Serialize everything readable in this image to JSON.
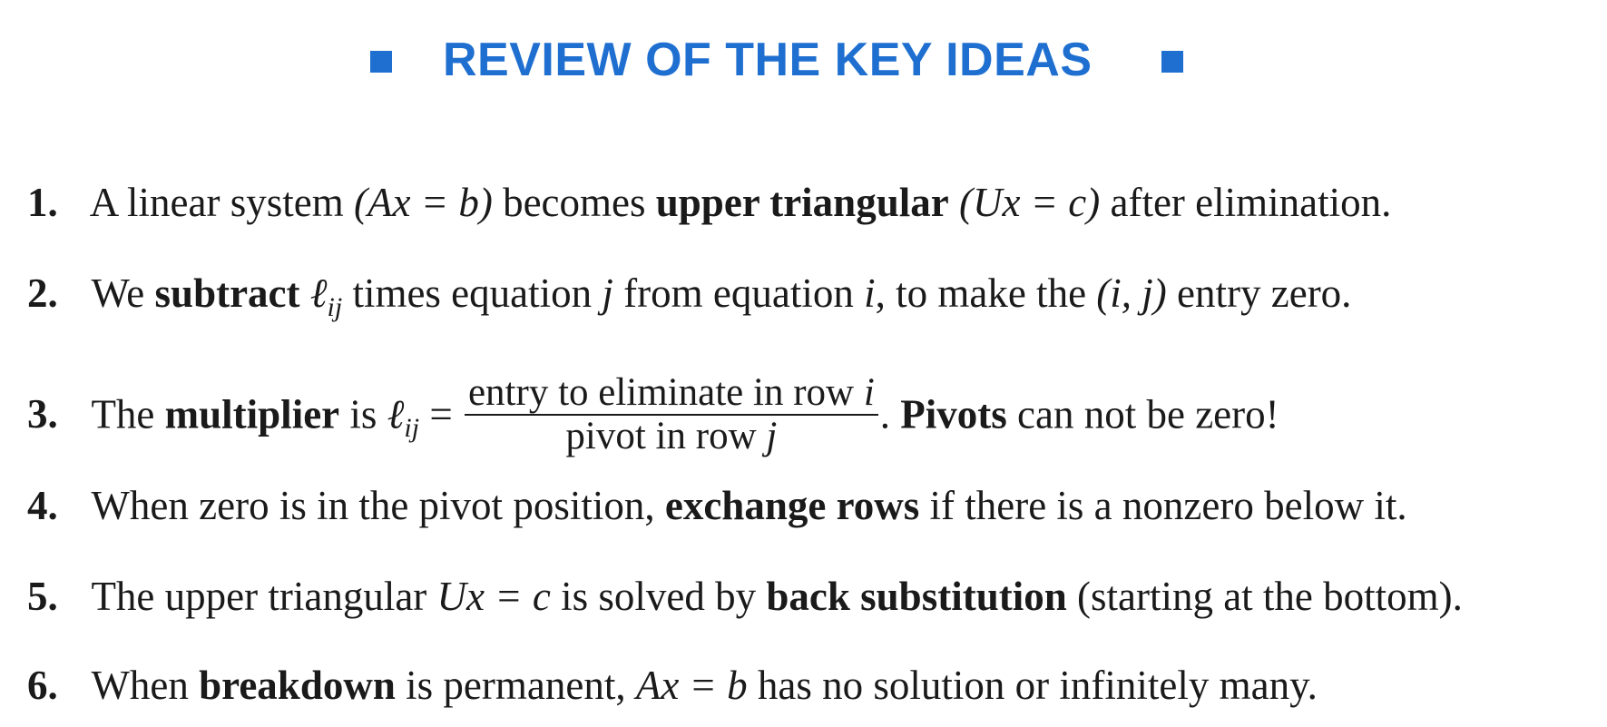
{
  "header": {
    "title": "REVIEW OF THE KEY IDEAS",
    "accent_color": "#1f6fd0"
  },
  "items": [
    {
      "num": "1.",
      "t1": "A linear system",
      "m1": "(Ax = b)",
      "t2": "becomes",
      "bold": "upper triangular",
      "m2": "(Ux = c)",
      "t3": "after elimination."
    },
    {
      "num": "2.",
      "t1": "We",
      "bold": "subtract",
      "ell": "ℓ",
      "sub": "ij",
      "t2": "times equation",
      "m1": "j",
      "t3": "from equation",
      "m2": "i",
      "t4": ", to make the",
      "m3": "(i, j)",
      "t5": "entry zero."
    },
    {
      "num": "3.",
      "t1": "The",
      "bold": "multiplier",
      "t2": "is",
      "ell": "ℓ",
      "sub": "ij",
      "eq": "=",
      "numerator": "entry to eliminate in row",
      "numerator_var": "i",
      "denominator": "pivot in row",
      "denominator_var": "j",
      "t3": ".",
      "bold2": "Pivots",
      "t4": "can not be zero!"
    },
    {
      "num": "4.",
      "t1": "When zero is in the pivot position,",
      "bold": "exchange rows",
      "t2": "if there is a nonzero below it."
    },
    {
      "num": "5.",
      "t1": "The upper triangular",
      "m1": "Ux = c",
      "t2": "is solved by",
      "bold": "back substitution",
      "t3": "(starting at the bottom)."
    },
    {
      "num": "6.",
      "t1": "When",
      "bold": "breakdown",
      "t2": "is permanent,",
      "m1": "Ax = b",
      "t3": "has no solution or infinitely many."
    }
  ]
}
